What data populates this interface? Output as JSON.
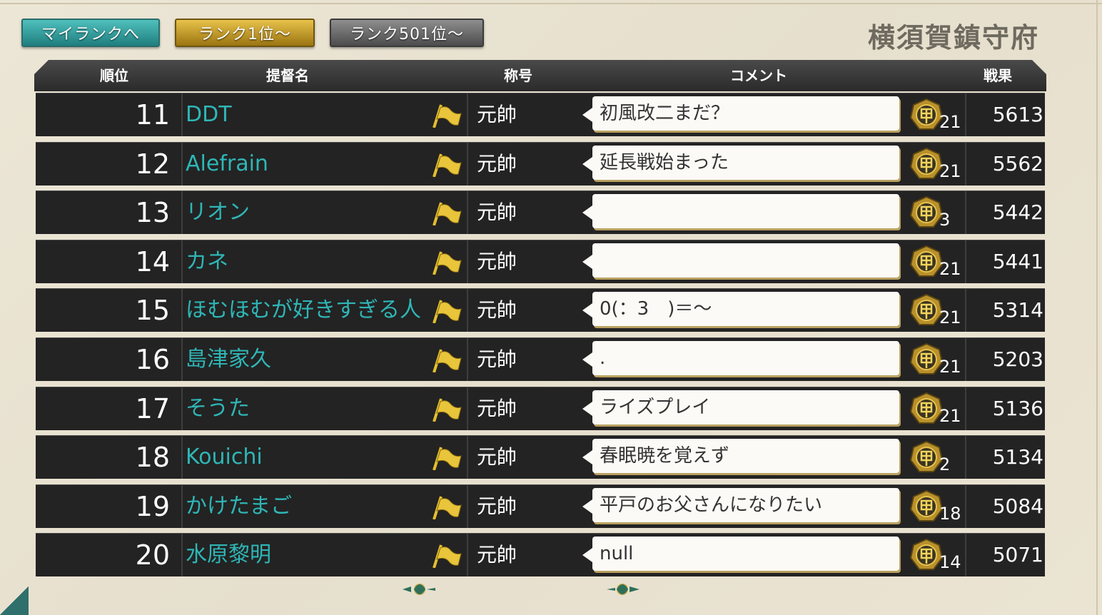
{
  "buttons": {
    "my_rank": "マイランクへ",
    "rank_1": "ランク1位～",
    "rank_501": "ランク501位～"
  },
  "base_name": "横須賀鎮守府",
  "headers": {
    "rank": "順位",
    "admiral_name": "提督名",
    "title": "称号",
    "comment": "コメント",
    "score": "戦果"
  },
  "rows": [
    {
      "rank": "11",
      "name": "DDT",
      "title": "元帥",
      "comment": "初風改二まだ？",
      "medal_count": "21",
      "score": "5613"
    },
    {
      "rank": "12",
      "name": "Alefrain",
      "title": "元帥",
      "comment": "延長戦始まった",
      "medal_count": "21",
      "score": "5562"
    },
    {
      "rank": "13",
      "name": "リオン",
      "title": "元帥",
      "comment": "",
      "medal_count": "3",
      "score": "5442"
    },
    {
      "rank": "14",
      "name": "カネ",
      "title": "元帥",
      "comment": "",
      "medal_count": "21",
      "score": "5441"
    },
    {
      "rank": "15",
      "name": "ほむほむが好きすぎる人",
      "title": "元帥",
      "comment": "0(：3　)＝～",
      "medal_count": "21",
      "score": "5314"
    },
    {
      "rank": "16",
      "name": "島津家久",
      "title": "元帥",
      "comment": ".",
      "medal_count": "21",
      "score": "5203"
    },
    {
      "rank": "17",
      "name": "そうた",
      "title": "元帥",
      "comment": "ライズプレイ",
      "medal_count": "21",
      "score": "5136"
    },
    {
      "rank": "18",
      "name": "Kouichi",
      "title": "元帥",
      "comment": "春眠暁を覚えず",
      "medal_count": "2",
      "score": "5134"
    },
    {
      "rank": "19",
      "name": "かけたまご",
      "title": "元帥",
      "comment": "平戸のお父さんになりたい",
      "medal_count": "18",
      "score": "5084"
    },
    {
      "rank": "20",
      "name": "水原黎明",
      "title": "元帥",
      "comment": "null",
      "medal_count": "14",
      "score": "5071"
    }
  ],
  "icons": {
    "flag": "flag-icon",
    "medal": "kou-medal-icon",
    "ornament": "ornament-icon"
  },
  "colors": {
    "name_text": "#2fb6b6",
    "row_bg": "#232323",
    "gold": "#d9b23a"
  }
}
